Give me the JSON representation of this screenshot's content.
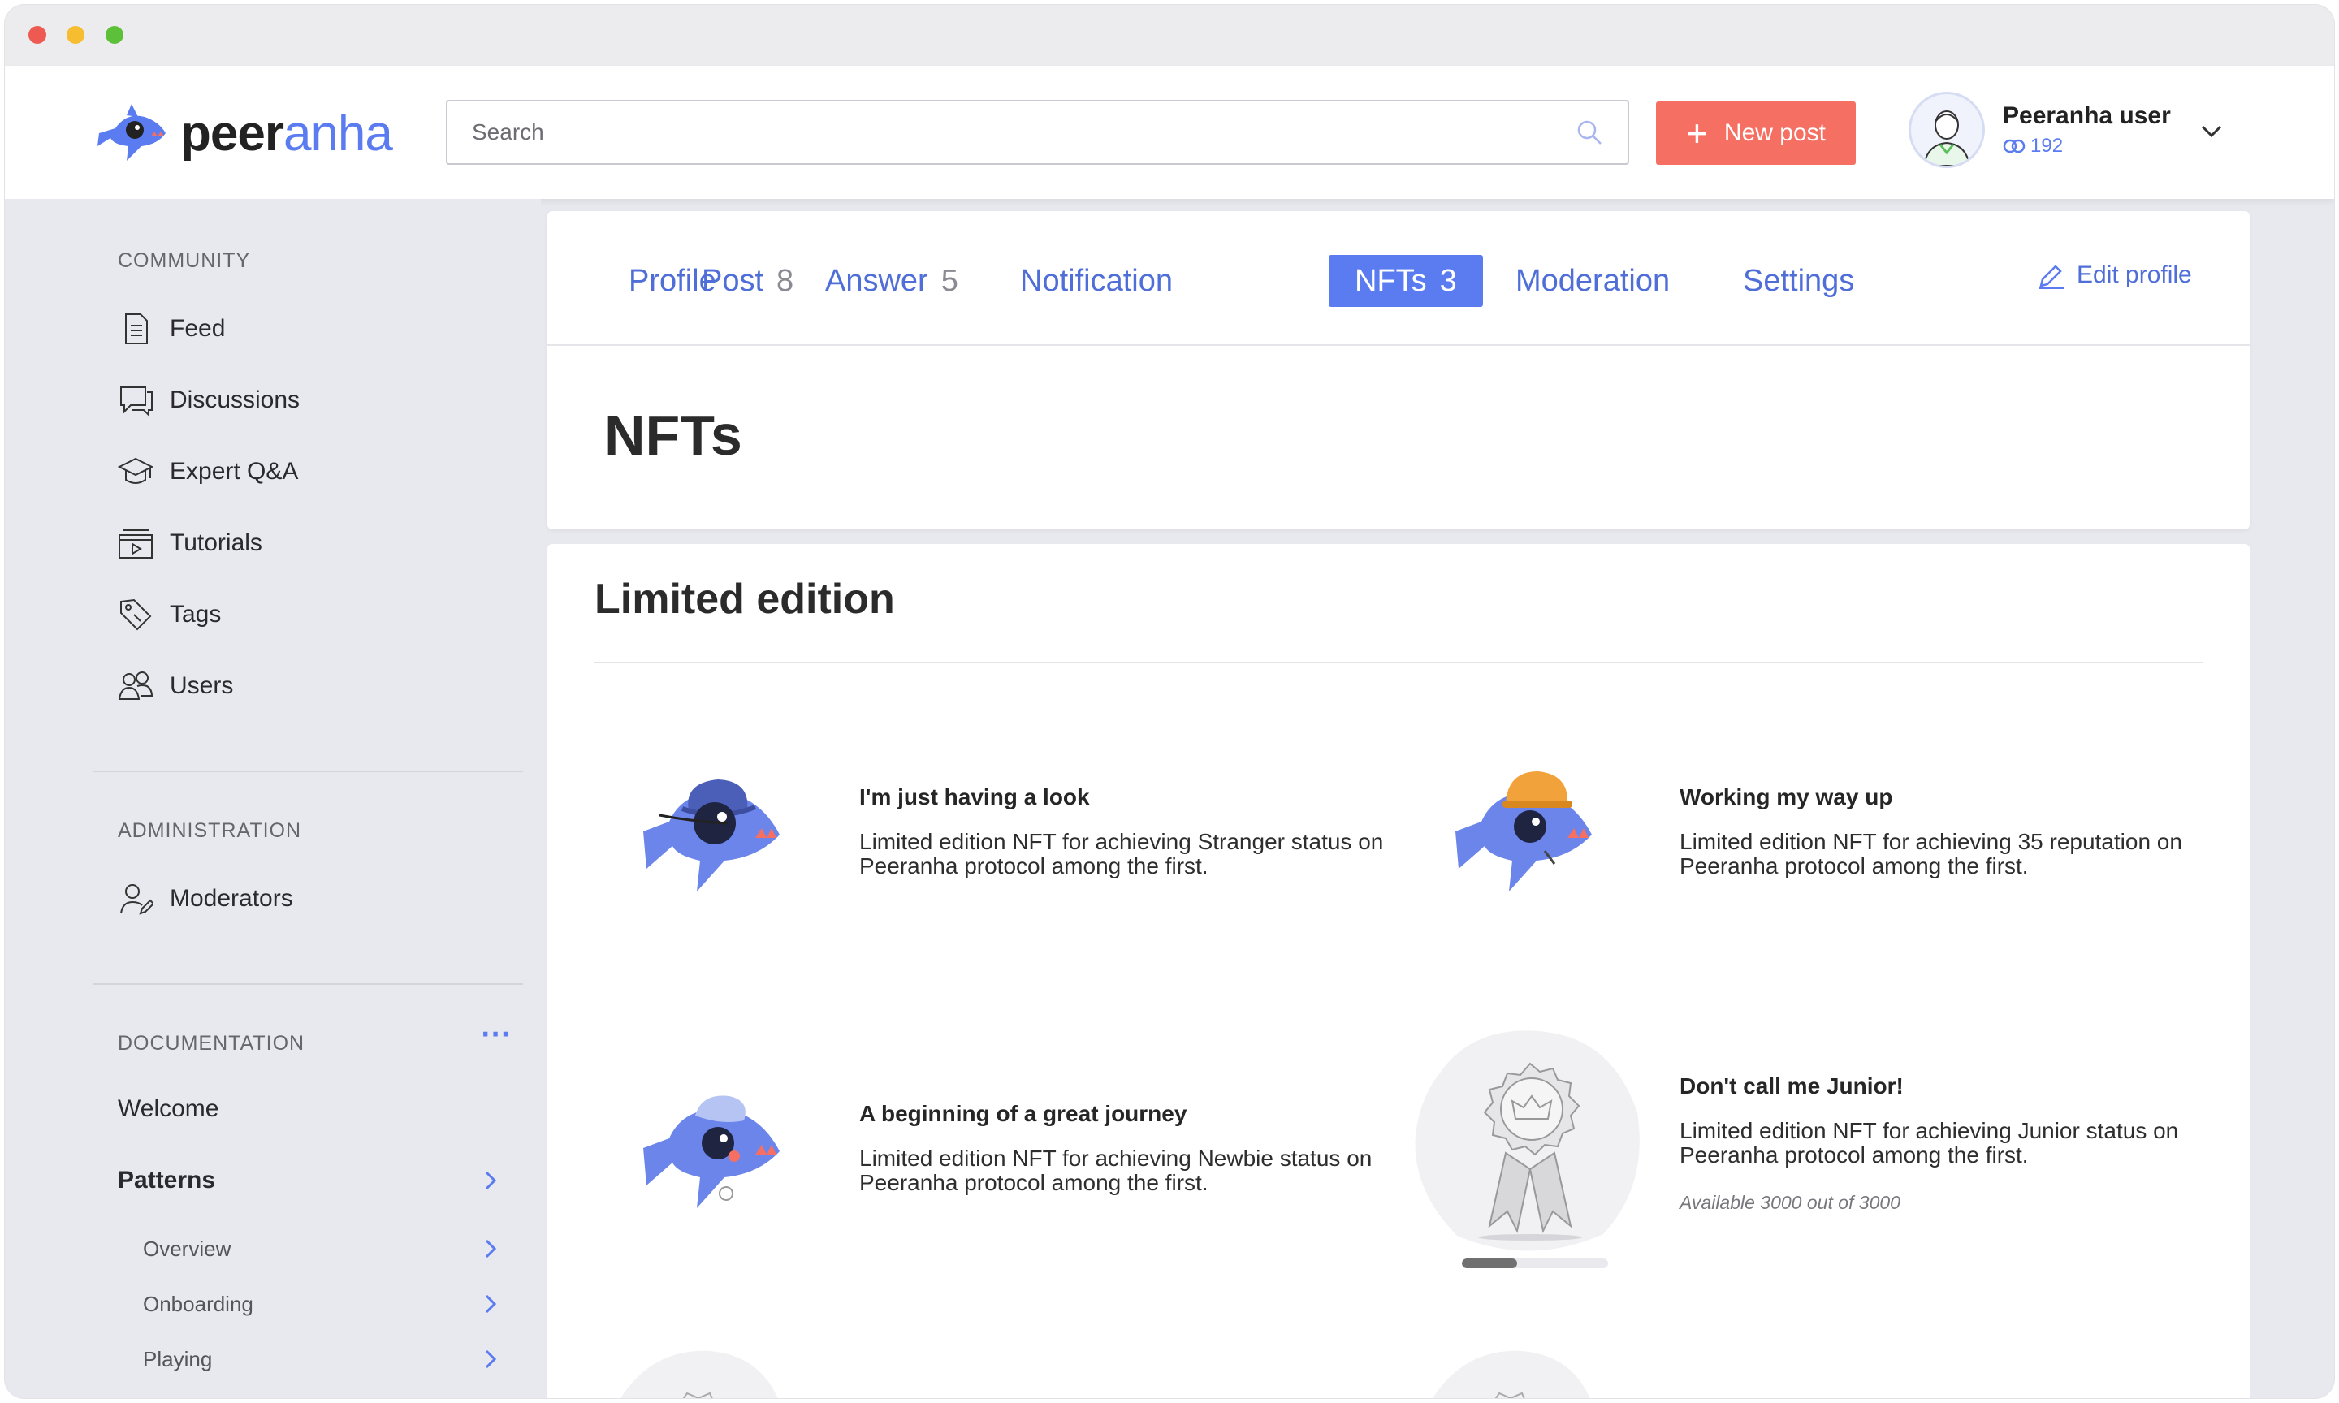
{
  "app": {
    "logo_prefix": "peer",
    "logo_suffix": "anha"
  },
  "header": {
    "search_placeholder": "Search",
    "new_post_label": "New post",
    "user_name": "Peeranha user",
    "user_rating": "192"
  },
  "sidebar": {
    "community_title": "COMMUNITY",
    "community_items": [
      {
        "label": "Feed",
        "icon": "feed-icon"
      },
      {
        "label": "Discussions",
        "icon": "discussions-icon"
      },
      {
        "label": "Expert Q&A",
        "icon": "expert-icon"
      },
      {
        "label": "Tutorials",
        "icon": "tutorials-icon"
      },
      {
        "label": "Tags",
        "icon": "tag-icon"
      },
      {
        "label": "Users",
        "icon": "users-icon"
      }
    ],
    "administration_title": "ADMINISTRATION",
    "administration_items": [
      {
        "label": "Moderators",
        "icon": "moderators-icon"
      }
    ],
    "documentation_title": "DOCUMENTATION",
    "documentation_more": "···",
    "documentation_items": [
      {
        "label": "Welcome"
      },
      {
        "label": "Patterns"
      }
    ],
    "documentation_subitems": [
      {
        "label": "Overview"
      },
      {
        "label": "Onboarding"
      },
      {
        "label": "Playing"
      }
    ]
  },
  "tabs": [
    {
      "label": "Profile",
      "count": ""
    },
    {
      "label": "Post",
      "count": "8"
    },
    {
      "label": "Answer",
      "count": "5"
    },
    {
      "label": "Notification",
      "count": ""
    },
    {
      "label": "NFTs",
      "count": "3",
      "active": true
    },
    {
      "label": "Moderation",
      "count": ""
    },
    {
      "label": "Settings",
      "count": ""
    }
  ],
  "edit_profile_label": "Edit profile",
  "page_title": "NFTs",
  "section_title": "Limited edition",
  "nfts": [
    {
      "title": "I'm just having a look",
      "description": "Limited edition NFT for achieving Stranger status on Peeranha protocol among the first.",
      "image": "shark-detective-hat-icon"
    },
    {
      "title": "Working my way up",
      "description": "Limited edition NFT for achieving 35 reputation on Peeranha protocol among the first.",
      "image": "shark-hard-hat-icon"
    },
    {
      "title": "A beginning of a great journey",
      "description": "Limited edition NFT for achieving Newbie status on Peeranha protocol among the first.",
      "image": "shark-cap-icon"
    },
    {
      "title": "Don't call me Junior!",
      "description": "Limited edition NFT for achieving Junior status on Peeranha protocol among the first.",
      "availability": "Available 3000 out of 3000",
      "progress": 0.38,
      "image": "award-ribbon-icon"
    }
  ],
  "colors": {
    "accent": "#5b7cf0",
    "new_post": "#f56f63",
    "background": "#e8e9ee"
  }
}
